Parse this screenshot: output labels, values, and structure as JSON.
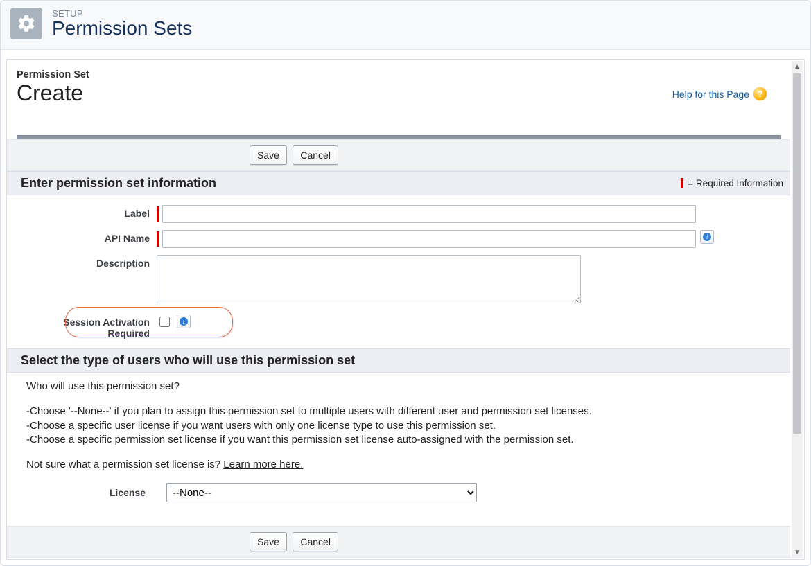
{
  "header": {
    "setup_label": "SETUP",
    "page_title": "Permission Sets"
  },
  "help": {
    "link_text": "Help for this Page"
  },
  "entity": {
    "object_label": "Permission Set",
    "action_label": "Create"
  },
  "buttons": {
    "save": "Save",
    "cancel": "Cancel"
  },
  "section1": {
    "title": "Enter permission set information",
    "required_legend": "= Required Information",
    "fields": {
      "label_label": "Label",
      "api_name_label": "API Name",
      "description_label": "Description",
      "session_activation_label_line1": "Session Activation",
      "session_activation_label_line2": "Required"
    },
    "values": {
      "label": "",
      "api_name": "",
      "description": "",
      "session_activation_required": false
    }
  },
  "section2": {
    "title": "Select the type of users who will use this permission set",
    "question": "Who will use this permission set?",
    "bullets": [
      "Choose '--None--' if you plan to assign this permission set to multiple users with different user and permission set licenses.",
      "Choose a specific user license if you want users with only one license type to use this permission set.",
      "Choose a specific permission set license if you want this permission set license auto-assigned with the permission set."
    ],
    "learn_prefix": "Not sure what a permission set license is? ",
    "learn_link": "Learn more here.",
    "license_label": "License",
    "license_value": "--None--",
    "license_options": [
      "--None--"
    ]
  }
}
